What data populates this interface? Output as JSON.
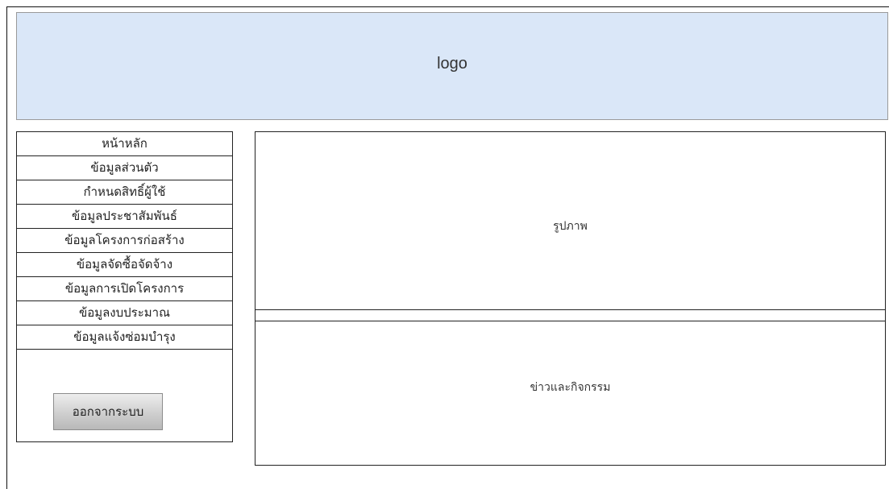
{
  "header": {
    "logo_text": "logo"
  },
  "sidebar": {
    "items": [
      {
        "label": "หน้าหลัก"
      },
      {
        "label": "ข้อมูลส่วนตัว"
      },
      {
        "label": "กำหนดสิทธิ์ผู้ใช้"
      },
      {
        "label": "ข้อมูลประชาสัมพันธ์"
      },
      {
        "label": "ข้อมูลโครงการก่อสร้าง"
      },
      {
        "label": "ข้อมูลจัดซื้อจัดจ้าง"
      },
      {
        "label": "ข้อมูลการเปิดโครงการ"
      },
      {
        "label": "ข้อมูลงบประมาณ"
      },
      {
        "label": "ข้อมูลแจ้งซ่อมบำรุง"
      }
    ],
    "logout_label": "ออกจากระบบ"
  },
  "main": {
    "image_panel_label": "รูปภาพ",
    "news_panel_label": "ข่าวและกิจกรรม"
  },
  "colors": {
    "header_background": "#dae7f8",
    "border": "#222222"
  }
}
